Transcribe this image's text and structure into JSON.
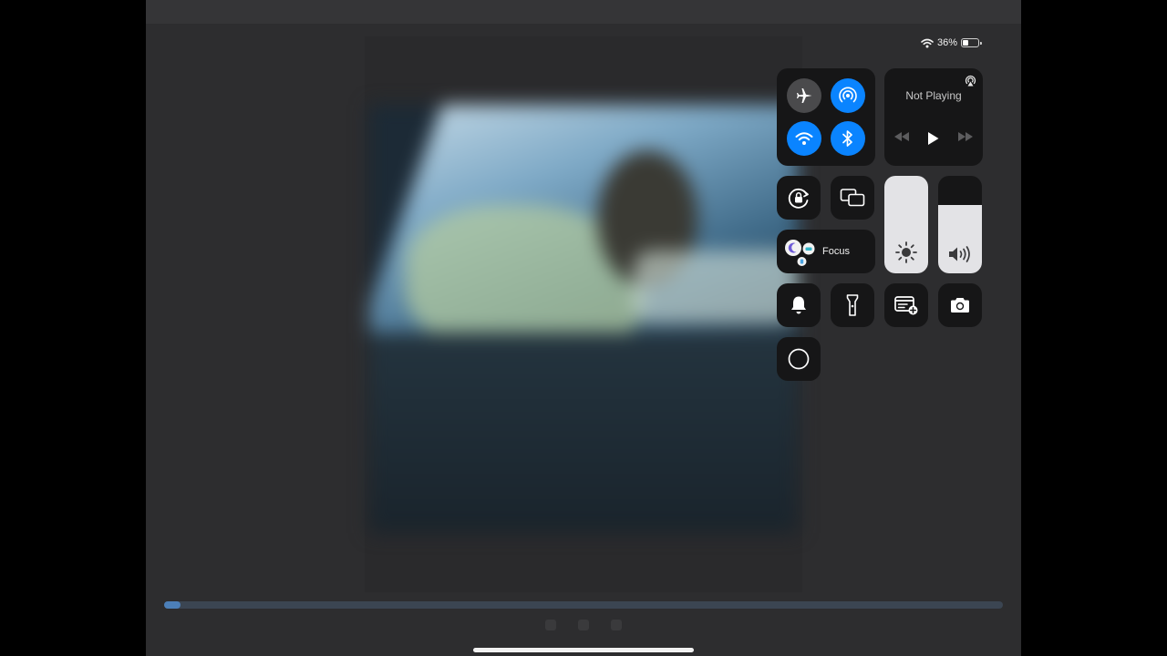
{
  "status_bar": {
    "battery_percent_text": "36%",
    "battery_level": 0.36
  },
  "control_center": {
    "connectivity": {
      "airplane_mode": "off",
      "airdrop": "on",
      "wifi": "on",
      "bluetooth": "on"
    },
    "now_playing": {
      "title": "Not Playing"
    },
    "focus": {
      "label": "Focus"
    },
    "brightness_level": 1.0,
    "volume_level": 0.7
  },
  "colors": {
    "accent_blue": "#0a84ff",
    "tile_background": "#161617",
    "slider_fill": "#e3e3e6"
  },
  "video_player": {
    "progress": 0.02
  }
}
